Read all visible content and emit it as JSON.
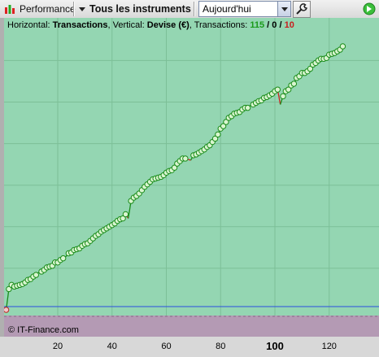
{
  "toolbar": {
    "performance_label": "Performance",
    "instruments_label": "Tous les instruments",
    "date_selected": "Aujourd'hui",
    "wrench_icon": "wrench-icon",
    "nav_icon": "green-arrow-icon"
  },
  "chart_header": {
    "prefix_horizontal": "Horizontal: ",
    "horizontal_value": "Transactions",
    "prefix_vertical": ", Vertical: ",
    "vertical_value": "Devise (€)",
    "prefix_transactions": ", Transactions: ",
    "total": "115",
    "sep1": " / ",
    "neutral": "0",
    "sep2": " / ",
    "losses": "10"
  },
  "copyright": "© IT-Finance.com",
  "colors": {
    "plot_bg": "#94d6b2",
    "loss_zone": "#b49ab4",
    "winning_line": "#1a8c1a",
    "losing_line": "#cc2222",
    "marker_fill": "#d9f5d0",
    "baseline": "#2a4de0",
    "grid": "#7cbf97"
  },
  "chart_data": {
    "type": "line",
    "x_label": "Transactions",
    "y_label": "Devise (€)",
    "xlim": [
      1,
      130
    ],
    "x_ticks": [
      20,
      40,
      60,
      80,
      100,
      120
    ],
    "major_tick": 100,
    "x": [
      1,
      2,
      3,
      4,
      5,
      6,
      7,
      8,
      9,
      10,
      11,
      12,
      13,
      14,
      15,
      16,
      17,
      18,
      19,
      20,
      21,
      22,
      23,
      24,
      25,
      26,
      27,
      28,
      29,
      30,
      31,
      32,
      33,
      34,
      35,
      36,
      37,
      38,
      39,
      40,
      41,
      42,
      43,
      44,
      45,
      46,
      47,
      48,
      49,
      50,
      51,
      52,
      53,
      54,
      55,
      56,
      57,
      58,
      59,
      60,
      61,
      62,
      63,
      64,
      65,
      66,
      67,
      68,
      69,
      70,
      71,
      72,
      73,
      74,
      75,
      76,
      77,
      78,
      79,
      80,
      81,
      82,
      83,
      84,
      85,
      86,
      87,
      88,
      89,
      90,
      91,
      92,
      93,
      94,
      95,
      96,
      97,
      98,
      99,
      100,
      101,
      102,
      103,
      104,
      105,
      106,
      107,
      108,
      109,
      110,
      111,
      112,
      113,
      114,
      115,
      116,
      117,
      118,
      119,
      120,
      121,
      122,
      123,
      124,
      125
    ],
    "y": [
      0,
      25,
      30,
      28,
      29,
      30,
      31,
      33,
      36,
      37,
      40,
      42,
      45,
      46,
      48,
      51,
      52,
      53,
      57,
      57,
      60,
      62,
      64,
      68,
      69,
      72,
      73,
      74,
      77,
      79,
      80,
      83,
      86,
      89,
      91,
      94,
      96,
      98,
      100,
      102,
      104,
      107,
      109,
      110,
      115,
      110,
      131,
      135,
      137,
      140,
      144,
      148,
      151,
      154,
      157,
      158,
      159,
      160,
      162,
      165,
      167,
      168,
      171,
      176,
      179,
      182,
      182,
      181,
      180,
      186,
      187,
      189,
      191,
      193,
      196,
      198,
      202,
      206,
      211,
      218,
      221,
      226,
      231,
      233,
      236,
      237,
      238,
      241,
      243,
      243,
      246,
      247,
      249,
      251,
      252,
      255,
      256,
      258,
      260,
      263,
      265,
      247,
      257,
      263,
      265,
      270,
      272,
      279,
      281,
      285,
      285,
      287,
      290,
      295,
      297,
      300,
      302,
      302,
      303,
      307,
      308,
      309,
      311,
      313,
      317
    ],
    "loss_indices": [
      12,
      22,
      45,
      67,
      68,
      90,
      101
    ],
    "baseline_y": 0
  }
}
